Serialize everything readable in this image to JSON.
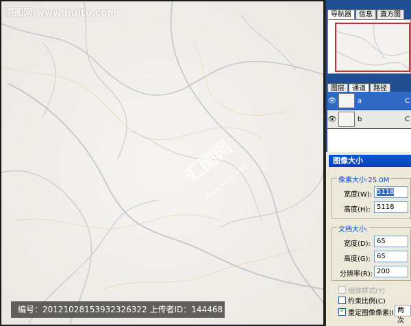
{
  "canvas": {
    "watermark_top": "汇图网 www.huitu.com",
    "center_logo": "汇图网",
    "center_logo_sub": "www.huitu.com",
    "bottom_info": "编号：20121028153932326322 上传者ID：144468"
  },
  "navigator": {
    "tabs": [
      "导航器",
      "信息",
      "直方图"
    ]
  },
  "channels": {
    "tabs": [
      "图层",
      "通道",
      "路径"
    ],
    "rows": [
      {
        "name": "a",
        "key": "C",
        "selected": true
      },
      {
        "name": "b",
        "key": "C",
        "selected": false
      }
    ]
  },
  "dialog": {
    "title": "图像大小",
    "pixel_group": "像素大小:25.0M",
    "width_label": "宽度(W):",
    "width_value": "5118",
    "height_label": "高度(H):",
    "height_value": "5118",
    "doc_group": "文档大小:",
    "doc_width_label": "宽度(D):",
    "doc_width_value": "65",
    "doc_height_label": "高度(G):",
    "doc_height_value": "65",
    "resolution_label": "分辨率(R):",
    "resolution_value": "200",
    "scale_styles": "缩放样式(Y)",
    "constrain": "约束比例(C)",
    "resample": "重定图像像素(I):",
    "resample_value": "两次"
  },
  "colors": {
    "panel_blue": "#1f4e92",
    "selected_row": "#3169c6",
    "dialog_bg": "#ece9d8",
    "marble_base": "#f1efec",
    "vein_gray": "#9aa3b2",
    "vein_gold": "#e8c79a"
  }
}
